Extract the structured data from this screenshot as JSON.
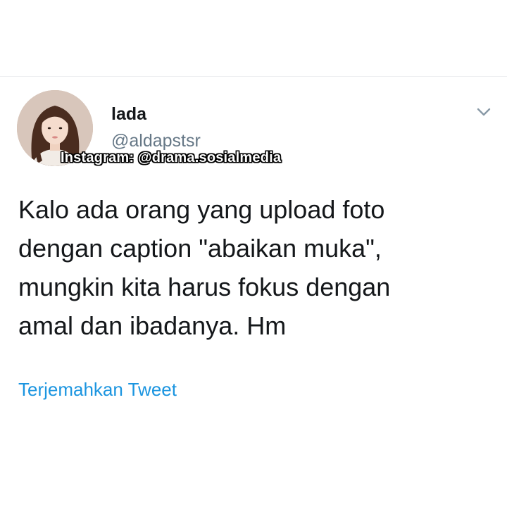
{
  "tweet": {
    "display_name": "lada",
    "handle": "@aldapstsr",
    "watermark": "Instagram: @drama.sosialmedia",
    "text_lines": [
      "Kalo ada orang yang upload foto",
      "dengan caption \"abaikan muka\",",
      "mungkin kita harus fokus dengan",
      "amal dan ibadanya. Hm"
    ],
    "translate_label": "Terjemahkan Tweet",
    "menu_icon": "chevron-down-icon",
    "colors": {
      "text": "#14171a",
      "secondary": "#657786",
      "link": "#1b95e0",
      "icon": "#8899a6"
    }
  }
}
